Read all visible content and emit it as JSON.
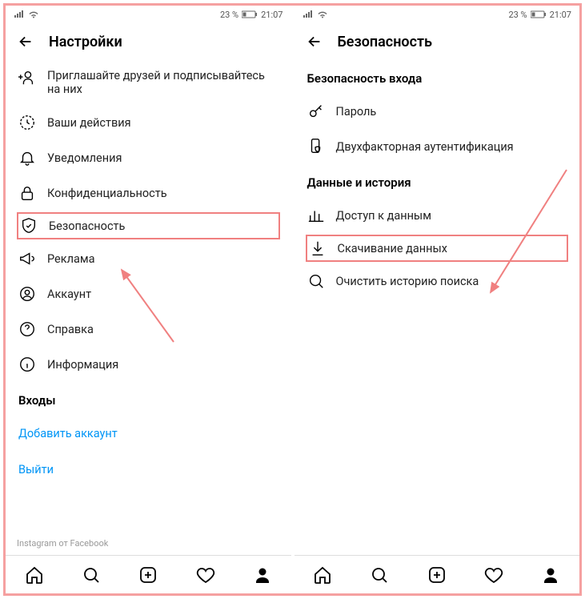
{
  "status": {
    "battery": "23 %",
    "time": "21:07"
  },
  "left": {
    "title": "Настройки",
    "items": [
      {
        "name": "invite-friends",
        "label": "Приглашайте друзей и подписывайтесь на них",
        "multiline": true
      },
      {
        "name": "your-activity",
        "label": "Ваши действия"
      },
      {
        "name": "notifications",
        "label": "Уведомления"
      },
      {
        "name": "privacy",
        "label": "Конфиденциальность"
      },
      {
        "name": "security",
        "label": "Безопасность",
        "highlight": true
      },
      {
        "name": "ads",
        "label": "Реклама"
      },
      {
        "name": "account",
        "label": "Аккаунт"
      },
      {
        "name": "help",
        "label": "Справка"
      },
      {
        "name": "about",
        "label": "Информация"
      }
    ],
    "section": "Входы",
    "links": [
      {
        "name": "add-account",
        "label": "Добавить аккаунт"
      },
      {
        "name": "logout",
        "label": "Выйти"
      }
    ],
    "footer": "Instagram от Facebook"
  },
  "right": {
    "title": "Безопасность",
    "section1": "Безопасность входа",
    "items1": [
      {
        "name": "password",
        "label": "Пароль"
      },
      {
        "name": "two-factor",
        "label": "Двухфакторная аутентификация"
      }
    ],
    "section2": "Данные и история",
    "items2": [
      {
        "name": "data-access",
        "label": "Доступ к данным"
      },
      {
        "name": "download-data",
        "label": "Скачивание данных",
        "highlight": true
      },
      {
        "name": "clear-search",
        "label": "Очистить историю поиска"
      }
    ]
  }
}
